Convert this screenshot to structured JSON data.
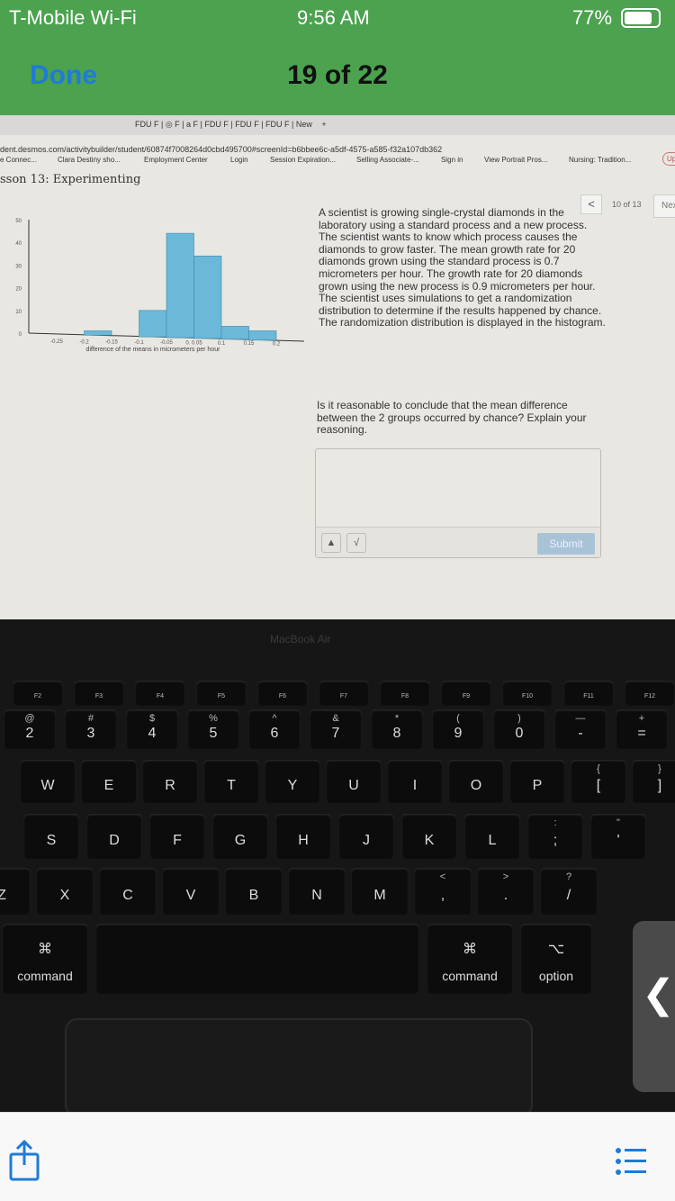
{
  "status": {
    "carrier": "T-Mobile Wi-Fi",
    "time": "9:56 AM",
    "battery": "77%"
  },
  "nav": {
    "done": "Done",
    "counter": "19 of 22"
  },
  "browser": {
    "tabs": "FDU F | ◎ F | a F | FDU F | FDU F | FDU F | New",
    "new_tab": "+",
    "url": "dent.desmos.com/activitybuilder/student/60874f7008264d0cbd495700#screenId=b6bbee6c-a5df-4575-a585-f32a107db362",
    "bookmarks": [
      "e Connec...",
      "Clara Destiny sho...",
      "Employment Center",
      "Login",
      "Session Expiration...",
      "Selling Associate-...",
      "Sign in",
      "View Portrait Pros...",
      "Nursing: Tradition..."
    ],
    "profile_button": "Up"
  },
  "lesson": {
    "title": "sson 13: Experimenting",
    "pager": "10 of 13",
    "next": "Nex"
  },
  "chart_data": {
    "type": "bar",
    "xlabel": "difference of the means in micrometers per hour",
    "ylabel": "",
    "ylim": [
      0,
      50
    ],
    "yticks": [
      "0",
      "10",
      "20",
      "30",
      "40",
      "50"
    ],
    "xticks": [
      "-0.25",
      "-0.2",
      "-0.15",
      "-0.1",
      "-0.05",
      "0. 0.05",
      "0.1",
      "0.15",
      "0.2"
    ],
    "bins": [
      {
        "from": "-0.2",
        "to": "-0.15",
        "count": 1
      },
      {
        "from": "-0.1",
        "to": "-0.05",
        "count": 10
      },
      {
        "from": "-0.05",
        "to": "0",
        "count": 44
      },
      {
        "from": "0.05",
        "to": "0.1",
        "count": 34
      },
      {
        "from": "0.1",
        "to": "0.15",
        "count": 3
      },
      {
        "from": "0.15",
        "to": "0.2",
        "count": 1
      }
    ],
    "bar_color": "#6cb8d8",
    "grid": false
  },
  "prompt": "A scientist is growing single-crystal diamonds in the laboratory using a standard process and a new process. The scientist wants to know which process causes the diamonds to grow faster. The mean growth rate for 20 diamonds grown using the standard process is 0.7 micrometers per hour. The growth rate for 20 diamonds grown using the new process is 0.9 micrometers per hour. The scientist uses simulations to get a randomization distribution to determine if the results happened by chance. The randomization distribution is displayed in the histogram.",
  "question": "Is it reasonable to conclude that the mean difference between the 2 groups occurred by chance? Explain your reasoning.",
  "answer": {
    "value": "",
    "submit": "Submit",
    "math": "√"
  },
  "laptop": {
    "brand": "MacBook Air"
  },
  "keyboard": {
    "frow": [
      "F2",
      "F3",
      "F4",
      "F5",
      "F6",
      "F7",
      "F8",
      "F9",
      "F10",
      "F11",
      "F12"
    ],
    "numrow": [
      [
        "@",
        "2"
      ],
      [
        "#",
        "3"
      ],
      [
        "$",
        "4"
      ],
      [
        "%",
        "5"
      ],
      [
        "^",
        "6"
      ],
      [
        "&",
        "7"
      ],
      [
        "*",
        "8"
      ],
      [
        "(",
        "9"
      ],
      [
        ")",
        "0"
      ],
      [
        "—",
        "-"
      ],
      [
        "+",
        "="
      ]
    ],
    "qrow": [
      [
        "",
        "W"
      ],
      [
        "",
        "E"
      ],
      [
        "",
        "R"
      ],
      [
        "",
        "T"
      ],
      [
        "",
        "Y"
      ],
      [
        "",
        "U"
      ],
      [
        "",
        "I"
      ],
      [
        "",
        "O"
      ],
      [
        "",
        "P"
      ],
      [
        "{",
        "["
      ],
      [
        "}",
        "]"
      ]
    ],
    "arow": [
      [
        "",
        "S"
      ],
      [
        "",
        "D"
      ],
      [
        "",
        "F"
      ],
      [
        "",
        "G"
      ],
      [
        "",
        "H"
      ],
      [
        "",
        "J"
      ],
      [
        "",
        "K"
      ],
      [
        "",
        "L"
      ],
      [
        ":",
        ";"
      ],
      [
        "\"",
        "'"
      ]
    ],
    "zrow": [
      [
        "",
        "Z"
      ],
      [
        "",
        "X"
      ],
      [
        "",
        "C"
      ],
      [
        "",
        "V"
      ],
      [
        "",
        "B"
      ],
      [
        "",
        "N"
      ],
      [
        "",
        "M"
      ],
      [
        "<",
        ","
      ],
      [
        ">",
        "."
      ],
      [
        "?",
        "/"
      ]
    ],
    "mods": [
      [
        "⌘",
        "command"
      ],
      [
        "",
        ""
      ],
      [
        "⌘",
        "command"
      ],
      [
        "⌥",
        "option"
      ]
    ]
  },
  "overlay": {
    "chevron": "❮"
  }
}
